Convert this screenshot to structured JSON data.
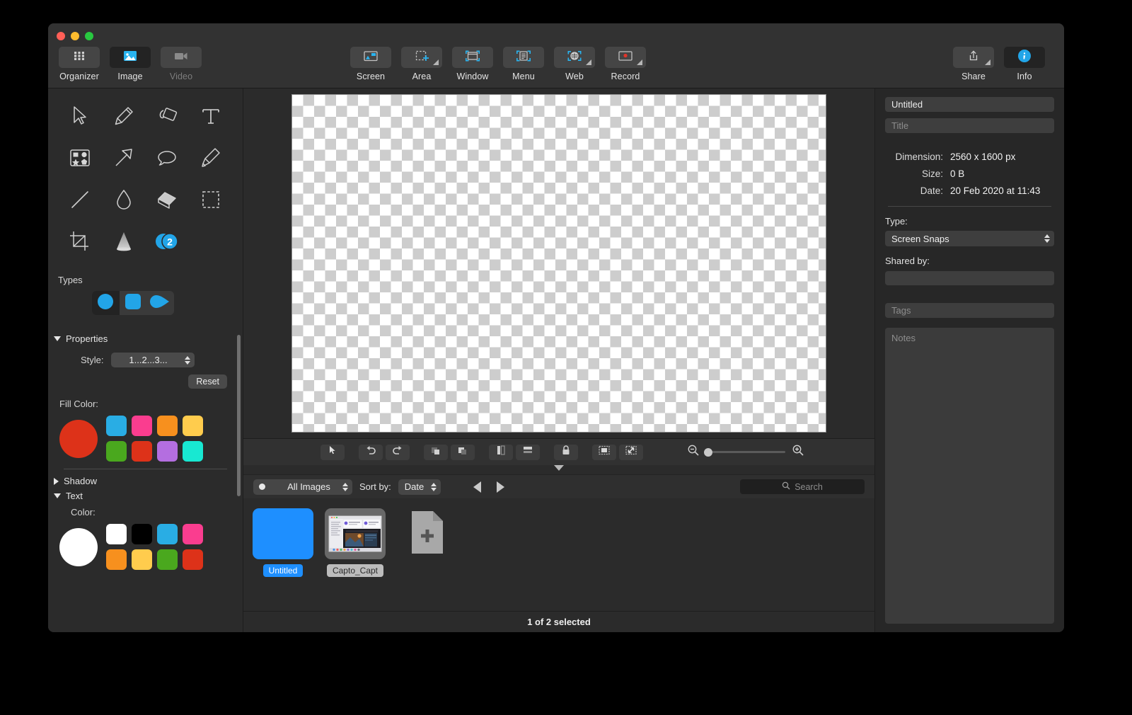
{
  "window": {
    "traffic_lights": [
      "close",
      "minimize",
      "zoom"
    ]
  },
  "toolbar": {
    "left_items": [
      {
        "label": "Organizer",
        "icon": "grid-icon",
        "state": "normal"
      },
      {
        "label": "Image",
        "icon": "image-icon",
        "state": "active"
      },
      {
        "label": "Video",
        "icon": "video-camera-icon",
        "state": "disabled"
      }
    ],
    "capture_items": [
      {
        "label": "Screen",
        "icon": "monitor-icon",
        "has_menu": false
      },
      {
        "label": "Area",
        "icon": "selection-crosshair-icon",
        "has_menu": true
      },
      {
        "label": "Window",
        "icon": "window-icon",
        "has_menu": false
      },
      {
        "label": "Menu",
        "icon": "menu-document-icon",
        "has_menu": false
      },
      {
        "label": "Web",
        "icon": "globe-icon",
        "has_menu": true
      },
      {
        "label": "Record",
        "icon": "record-monitor-icon",
        "has_menu": true
      }
    ],
    "right_items": [
      {
        "label": "Share",
        "icon": "share-upload-icon",
        "has_menu": true,
        "state": "normal"
      },
      {
        "label": "Info",
        "icon": "info-circle-icon",
        "has_menu": false,
        "state": "active"
      }
    ]
  },
  "tools": [
    {
      "name": "select-arrow-tool",
      "icon": "cursor-arrow-icon"
    },
    {
      "name": "pencil-tool",
      "icon": "pencil-icon"
    },
    {
      "name": "paint-bucket-tool",
      "icon": "paint-bucket-icon"
    },
    {
      "name": "text-tool",
      "icon": "text-t-icon"
    },
    {
      "name": "shapes-tool",
      "icon": "shapes-icon"
    },
    {
      "name": "arrow-tool",
      "icon": "arrow-diagonal-icon"
    },
    {
      "name": "callout-tool",
      "icon": "speech-bubble-icon"
    },
    {
      "name": "highlighter-tool",
      "icon": "highlighter-icon"
    },
    {
      "name": "line-tool",
      "icon": "line-icon"
    },
    {
      "name": "blur-tool",
      "icon": "droplet-icon"
    },
    {
      "name": "eraser-tool",
      "icon": "eraser-icon"
    },
    {
      "name": "marquee-tool",
      "icon": "dashed-rect-icon"
    },
    {
      "name": "crop-tool",
      "icon": "crop-icon"
    },
    {
      "name": "spotlight-tool",
      "icon": "spotlight-cone-icon"
    },
    {
      "name": "step-counter-tool",
      "icon": "step-number-icon",
      "badge": "2"
    }
  ],
  "left_panel": {
    "types_label": "Types",
    "types": [
      {
        "name": "circle-type",
        "shape": "circle",
        "selected": true
      },
      {
        "name": "rounded-square-type",
        "shape": "rounded-square",
        "selected": false
      },
      {
        "name": "teardrop-type",
        "shape": "teardrop",
        "selected": false
      }
    ],
    "properties_label": "Properties",
    "properties_expanded": true,
    "style_label": "Style:",
    "style_value": "1...2...3...",
    "reset_label": "Reset",
    "fill_color_label": "Fill Color:",
    "fill_current": "#dd3219",
    "fill_swatches": [
      "#29ade4",
      "#fa3d8f",
      "#f7901e",
      "#ffcc4d",
      "#4aa81e",
      "#dd3219",
      "#b46ee0",
      "#18e8d2"
    ],
    "shadow_label": "Shadow",
    "shadow_expanded": false,
    "text_label": "Text",
    "text_expanded": true,
    "text_color_label": "Color:",
    "text_current": "#ffffff",
    "text_swatches": [
      "#ffffff",
      "#000000",
      "#29ade4",
      "#fa3d8f",
      "#f7901e",
      "#ffcc4d",
      "#4aa81e",
      "#dd3219"
    ]
  },
  "canvas_toolbar": {
    "buttons": [
      {
        "name": "pointer-button",
        "icon": "cursor-arrow-icon"
      },
      {
        "name": "undo-button",
        "icon": "undo-arrow-icon"
      },
      {
        "name": "redo-button",
        "icon": "redo-arrow-icon"
      },
      {
        "name": "bring-forward-button",
        "icon": "layer-front-icon"
      },
      {
        "name": "send-backward-button",
        "icon": "layer-back-icon"
      },
      {
        "name": "align-vertical-button",
        "icon": "align-vertical-icon"
      },
      {
        "name": "align-horizontal-button",
        "icon": "align-horizontal-icon"
      },
      {
        "name": "lock-button",
        "icon": "lock-icon"
      },
      {
        "name": "fit-to-window-button",
        "icon": "fit-frame-icon"
      },
      {
        "name": "actual-size-button",
        "icon": "resize-frame-icon"
      }
    ],
    "zoom_out_icon": "magnifier-minus-icon",
    "zoom_in_icon": "magnifier-plus-icon",
    "zoom_position_percent": 2
  },
  "browser_bar": {
    "filter_value": "All Images",
    "sort_label": "Sort by:",
    "sort_value": "Date",
    "prev_icon": "triangle-left-icon",
    "next_icon": "triangle-right-icon",
    "search_placeholder": "Search",
    "search_icon": "search-icon"
  },
  "thumbnails": [
    {
      "name": "Untitled",
      "selected": true,
      "kind": "blank-blue"
    },
    {
      "name": "Capto_Capt",
      "selected": false,
      "kind": "screenshot"
    },
    {
      "name": "",
      "selected": false,
      "kind": "add-document"
    }
  ],
  "status_bar": {
    "text": "1 of 2 selected"
  },
  "info_panel": {
    "name_value": "Untitled",
    "title_placeholder": "Title",
    "rows": [
      {
        "key": "Dimension:",
        "value": "2560 x 1600 px"
      },
      {
        "key": "Size:",
        "value": "0 B"
      },
      {
        "key": "Date:",
        "value": "20 Feb 2020 at 11:43"
      }
    ],
    "type_label": "Type:",
    "type_value": "Screen Snaps",
    "shared_by_label": "Shared by:",
    "shared_by_value": "",
    "tags_placeholder": "Tags",
    "notes_placeholder": "Notes"
  },
  "colors": {
    "accent": "#1e8fff",
    "window_bg": "#2b2b2b",
    "toolbar_bg": "#323232",
    "panel_bg": "#272727"
  }
}
